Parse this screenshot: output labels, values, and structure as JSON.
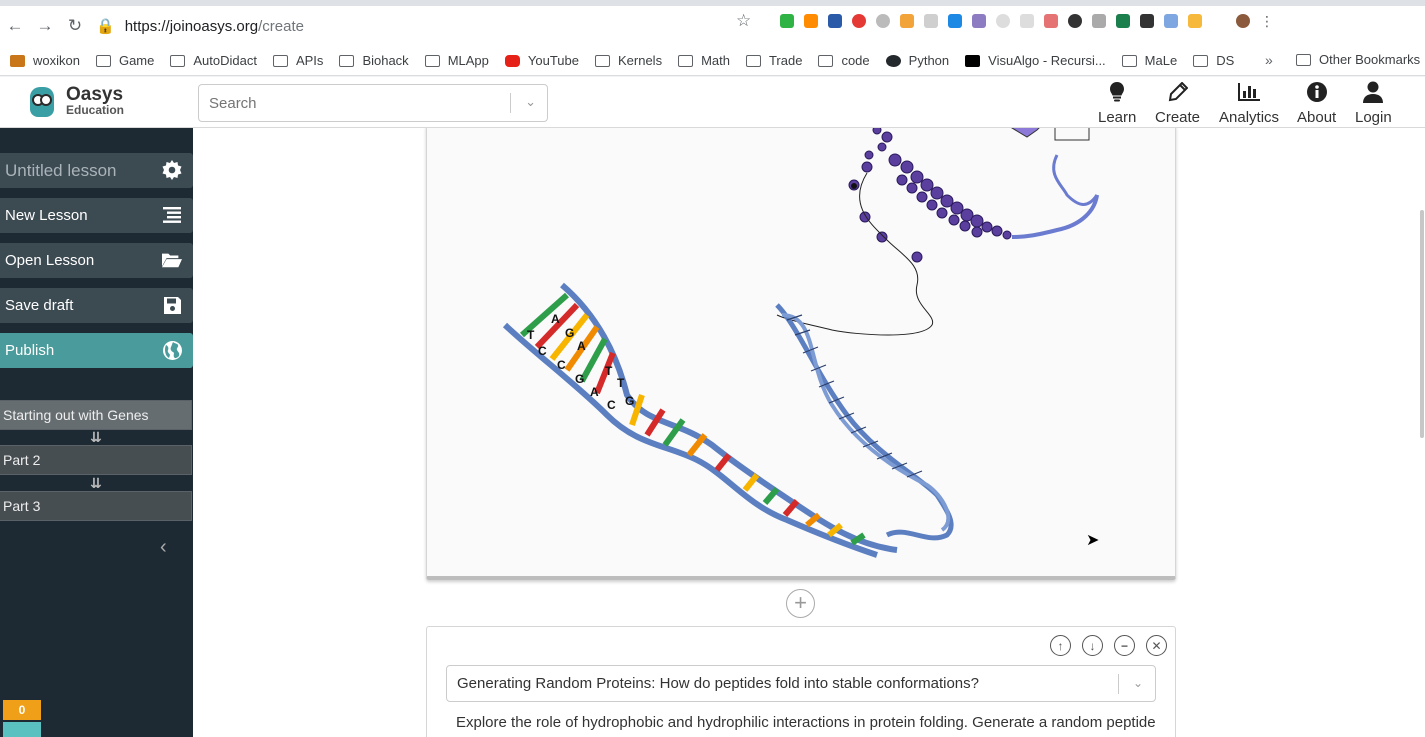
{
  "browser": {
    "url_host": "https://joinoasys.org",
    "url_path": "/create",
    "bookmarks": [
      "woxikon",
      "Game",
      "AutoDidact",
      "APIs",
      "Biohack",
      "MLApp",
      "YouTube",
      "Kernels",
      "Math",
      "Trade",
      "code",
      "Python",
      "VisuAlgo - Recursi...",
      "MaLe",
      "DS"
    ],
    "more_label": "»",
    "other_bookmarks": "Other Bookmarks"
  },
  "header": {
    "brand_name": "Oasys",
    "brand_sub": "Education",
    "search_placeholder": "Search",
    "nav": [
      {
        "label": "Learn",
        "icon": "lightbulb-icon"
      },
      {
        "label": "Create",
        "icon": "pencil-icon"
      },
      {
        "label": "Analytics",
        "icon": "bar-chart-icon"
      },
      {
        "label": "About",
        "icon": "info-icon"
      },
      {
        "label": "Login",
        "icon": "user-icon"
      }
    ]
  },
  "sidebar": {
    "lesson_title": "Untitled lesson",
    "new_lesson": "New Lesson",
    "open_lesson": "Open Lesson",
    "save_draft": "Save draft",
    "publish": "Publish",
    "parts": [
      "Starting out with Genes",
      "Part 2",
      "Part 3"
    ],
    "counter": "0",
    "colors": {
      "background": "#1d2a33",
      "button": "#3c4a52",
      "publish": "#4a9b9b",
      "counter": "#f0a018"
    }
  },
  "editor": {
    "image_letters": [
      "T",
      "A",
      "C",
      "G",
      "A",
      "C",
      "T",
      "G",
      "T",
      "A",
      "C",
      "G"
    ],
    "heading": "Generating Random Proteins: How do peptides fold into stable conformations?",
    "body": "Explore the role of hydrophobic and hydrophilic interactions in protein folding. Generate a random peptide"
  }
}
